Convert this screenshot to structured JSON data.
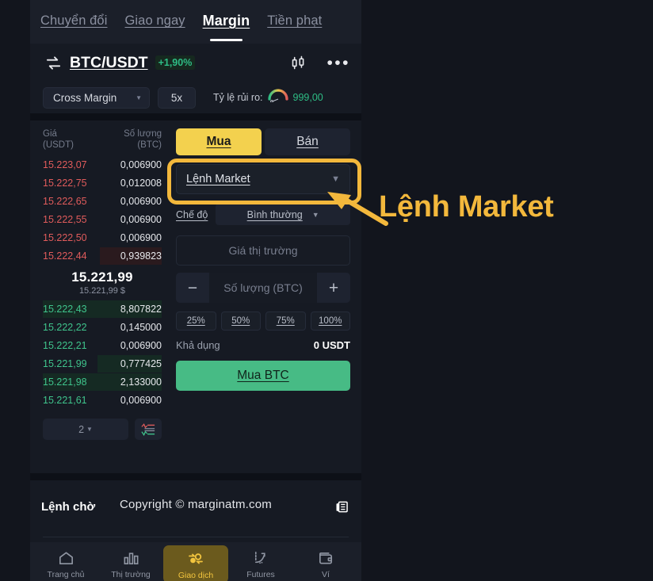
{
  "top_tabs": [
    {
      "label": "Chuyển đổi",
      "active": false
    },
    {
      "label": "Giao ngay",
      "active": false
    },
    {
      "label": "Margin",
      "active": true
    },
    {
      "label": "Tiền phạt",
      "active": false
    }
  ],
  "pair_header": {
    "swap_icon": "swap-arrows-icon",
    "pair": "BTC/USDT",
    "change": "+1,90%",
    "chart_icon": "candlestick-icon",
    "more_icon": "more-dots-icon"
  },
  "margin_controls": {
    "mode": "Cross Margin",
    "leverage": "5x",
    "risk_label": "Tỷ lệ rủi ro:",
    "risk_gauge_icon": "risk-gauge-icon",
    "risk_value": "999,00"
  },
  "orderbook": {
    "header_price": "Giá",
    "header_price_unit": "(USDT)",
    "header_amount": "Số lượng",
    "header_amount_unit": "(BTC)",
    "asks": [
      {
        "price": "15.223,07",
        "amount": "0,006900",
        "depth": 0
      },
      {
        "price": "15.222,75",
        "amount": "0,012008",
        "depth": 0
      },
      {
        "price": "15.222,65",
        "amount": "0,006900",
        "depth": 0
      },
      {
        "price": "15.222,55",
        "amount": "0,006900",
        "depth": 0
      },
      {
        "price": "15.222,50",
        "amount": "0,006900",
        "depth": 0
      },
      {
        "price": "15.222,44",
        "amount": "0,939823",
        "depth": 52
      }
    ],
    "last_price": "15.221,99",
    "last_price_usd": "15.221,99 $",
    "bids": [
      {
        "price": "15.222,43",
        "amount": "8,807822",
        "depth": 100
      },
      {
        "price": "15.222,22",
        "amount": "0,145000",
        "depth": 0
      },
      {
        "price": "15.222,21",
        "amount": "0,006900",
        "depth": 0
      },
      {
        "price": "15.221,99",
        "amount": "0,777425",
        "depth": 54
      },
      {
        "price": "15.221,98",
        "amount": "2,133000",
        "depth": 100
      },
      {
        "price": "15.221,61",
        "amount": "0,006900",
        "depth": 0
      }
    ],
    "grouping": "2",
    "depth_view_icon": "orderbook-depth-icon"
  },
  "trade_panel": {
    "buy_tab": "Mua",
    "sell_tab": "Bán",
    "order_type": "Lệnh Market",
    "order_type_caret_icon": "chevron-down-icon",
    "mode_label": "Chế độ",
    "mode_value": "Bình thường",
    "mode_caret_icon": "chevron-down-icon",
    "price_placeholder": "Giá thị trường",
    "minus_icon": "minus-icon",
    "amount_placeholder": "Số lượng (BTC)",
    "plus_icon": "plus-icon",
    "percents": [
      "25%",
      "50%",
      "75%",
      "100%"
    ],
    "available_label": "Khả dụng",
    "available_value": "0 USDT",
    "submit_label": "Mua BTC"
  },
  "bottom": {
    "pending_orders": "Lệnh chờ",
    "copyright": "Copyright © marginatm.com",
    "news_icon": "news-list-icon"
  },
  "navbar": [
    {
      "label": "Trang chủ",
      "icon": "home-icon",
      "active": false
    },
    {
      "label": "Thị trường",
      "icon": "bar-chart-icon",
      "active": false
    },
    {
      "label": "Giao dịch",
      "icon": "trade-swap-icon",
      "active": true
    },
    {
      "label": "Futures",
      "icon": "futures-trend-icon",
      "active": false
    },
    {
      "label": "Ví",
      "icon": "wallet-icon",
      "active": false
    }
  ],
  "annotation": {
    "text": "Lệnh Market",
    "color": "#f3b83c",
    "arrow_icon": "callout-arrow-icon"
  },
  "colors": {
    "page_bg": "#12151d",
    "panel_bg": "#161a23",
    "accent_yellow": "#f3d14e",
    "annotation_yellow": "#f3b83c",
    "buy_green": "#47bb85",
    "ask_red": "#e05b5b",
    "bid_green": "#3fc48c"
  }
}
